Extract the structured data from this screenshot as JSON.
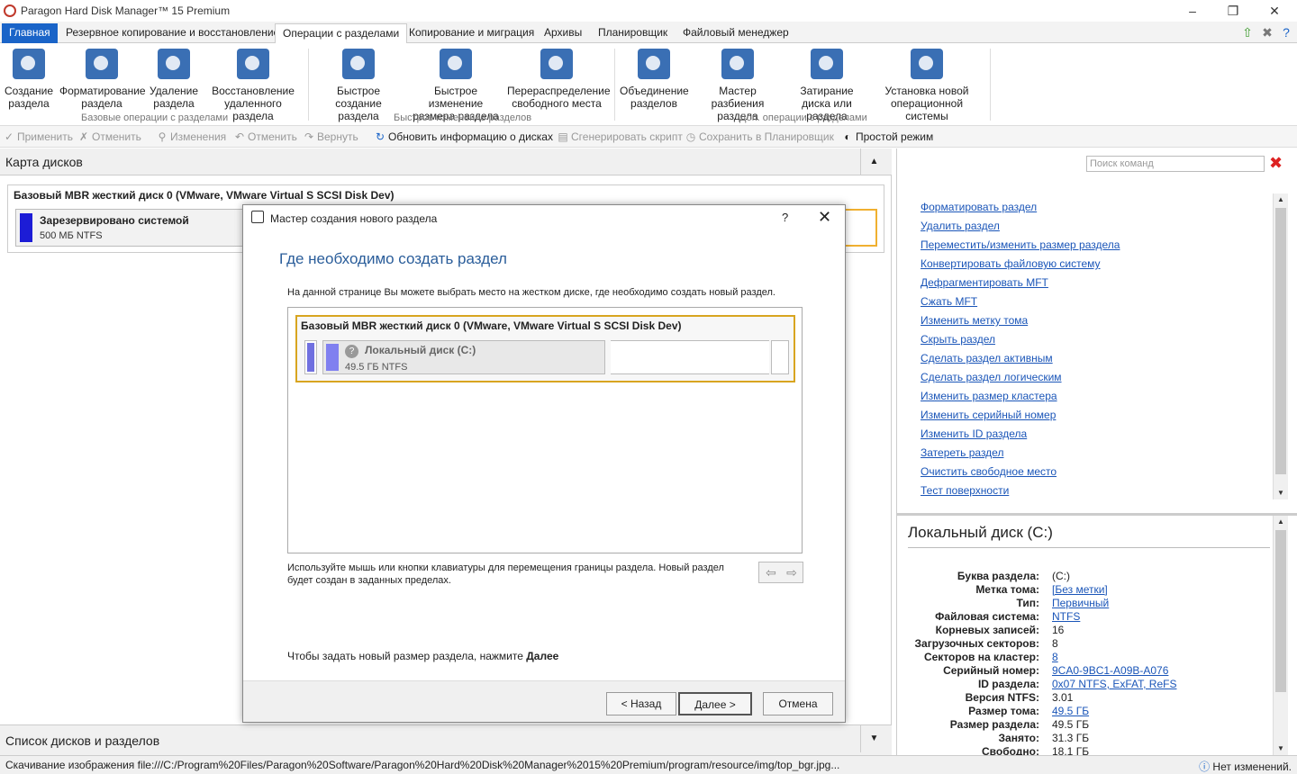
{
  "window": {
    "title": "Paragon Hard Disk Manager™ 15 Premium"
  },
  "menu": {
    "tabs": [
      "Главная",
      "Резервное копирование и восстановление",
      "Операции с разделами",
      "Копирование и миграция",
      "Архивы",
      "Планировщик",
      "Файловый менеджер"
    ],
    "active": "Операции с разделами"
  },
  "ribbon": {
    "b1": "Создание раздела",
    "b2": "Форматирование раздела",
    "b3": "Удаление раздела",
    "b4": "Восстановление удаленного раздела",
    "b5": "Быстрое создание раздела",
    "b6": "Быстрое изменение размера раздела",
    "b7": "Перераспределение свободного места",
    "b8": "Объединение разделов",
    "b9": "Мастер разбиения раздела",
    "b10": "Затирание диска или раздела",
    "b11": "Установка новой операционной системы",
    "g1": "Базовые операции с разделами",
    "g2": "Быстрое изменение разделов",
    "g3": "Доп. операции с разделами"
  },
  "toolbar": {
    "apply": "Применить",
    "cancel": "Отменить",
    "changes": "Изменения",
    "undo": "Отменить",
    "redo": "Вернуть",
    "refresh": "Обновить информацию о дисках",
    "script": "Сгенерировать скрипт",
    "save": "Сохранить в Планировщик",
    "simple": "Простой режим"
  },
  "left": {
    "title": "Карта дисков",
    "disk": "Базовый MBR жесткий диск 0 (VMware, VMware Virtual S SCSI Disk Dev)",
    "part_name": "Зарезервировано системой",
    "part_size": "500 МБ NTFS",
    "bottom_title": "Список дисков и разделов"
  },
  "right": {
    "search_placeholder": "Поиск команд",
    "commands": [
      "Форматировать раздел",
      "Удалить раздел",
      "Переместить/изменить размер раздела",
      "Конвертировать файловую систему",
      "Дефрагментировать MFT",
      "Сжать MFT",
      "Изменить метку тома",
      "Скрыть раздел",
      "Сделать раздел активным",
      "Сделать раздел логическим",
      "Изменить размер кластера",
      "Изменить серийный номер",
      "Изменить ID раздела",
      "Затереть раздел",
      "Очистить свободное место",
      "Тест поверхности"
    ],
    "info_title": "Локальный диск (C:)",
    "props": [
      [
        "Буква раздела:",
        "(C:)"
      ],
      [
        "Метка тома:",
        "[Без метки]"
      ],
      [
        "Тип:",
        "Первичный"
      ],
      [
        "Файловая система:",
        "NTFS"
      ],
      [
        "Корневых записей:",
        "16"
      ],
      [
        "Загрузочных секторов:",
        "8"
      ],
      [
        "Секторов на кластер:",
        "8"
      ],
      [
        "Серийный номер:",
        "9CA0-9BC1-A09B-A076"
      ],
      [
        "ID раздела:",
        "0x07 NTFS, ExFAT, ReFS"
      ],
      [
        "Версия NTFS:",
        "3.01"
      ],
      [
        "Размер тома:",
        "49.5 ГБ"
      ],
      [
        "Размер раздела:",
        "49.5 ГБ"
      ],
      [
        "Занято:",
        "31.3 ГБ"
      ],
      [
        "Свободно:",
        "18.1 ГБ"
      ]
    ]
  },
  "status": {
    "text": "Скачивание изображения file:///C:/Program%20Files/Paragon%20Software/Paragon%20Hard%20Disk%20Manager%2015%20Premium/program/resource/img/top_bgr.jpg...",
    "right": "Нет изменений."
  },
  "dialog": {
    "title": "Мастер создания нового раздела",
    "help": "?",
    "heading": "Где необходимо создать раздел",
    "desc": "На данной странице Вы можете выбрать место на жестком диске, где необходимо создать новый раздел.",
    "disk": "Базовый MBR жесткий диск 0 (VMware, VMware Virtual S SCSI Disk Dev)",
    "part_name": "Локальный диск (C:)",
    "part_size": "49.5 ГБ NTFS",
    "hint": "Используйте мышь или кнопки клавиатуры для перемещения границы раздела. Новый раздел будет создан в заданных пределах.",
    "next_text": "Чтобы задать новый размер раздела, нажмите ",
    "next_bold": "Далее",
    "back": "< Назад",
    "next": "Далее >",
    "cancel": "Отмена"
  }
}
